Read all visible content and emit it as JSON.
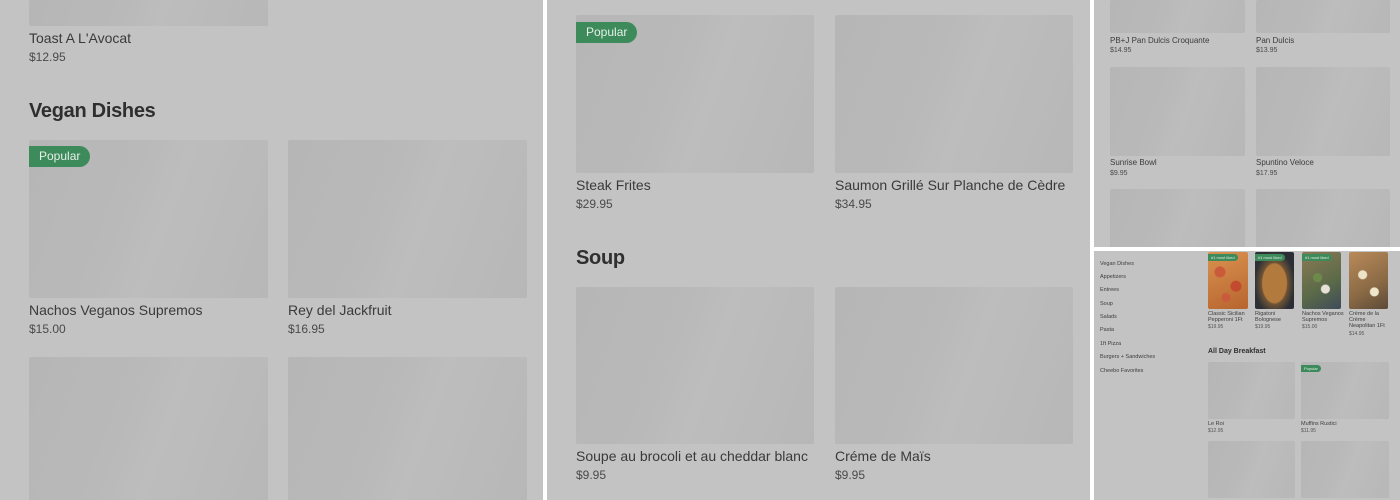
{
  "panel1": {
    "top_item": {
      "name": "Toast A L'Avocat",
      "price": "$12.95"
    },
    "section_title": "Vegan Dishes",
    "badge": "Popular",
    "items": [
      {
        "name": "Nachos Veganos Supremos",
        "price": "$15.00"
      },
      {
        "name": "Rey del Jackfruit",
        "price": "$16.95"
      }
    ]
  },
  "panel2": {
    "badge": "Popular",
    "items_top": [
      {
        "name": "Steak Frites",
        "price": "$29.95"
      },
      {
        "name": "Saumon Grillé Sur Planche de Cèdre",
        "price": "$34.95"
      }
    ],
    "section_title": "Soup",
    "items_soup": [
      {
        "name": "Soupe au brocoli et au cheddar blanc",
        "price": "$9.95"
      },
      {
        "name": "Créme de Maïs",
        "price": "$9.95"
      }
    ]
  },
  "panel3": {
    "items": [
      {
        "name": "PB+J Pan Dulcis Croquante",
        "price": "$14.95"
      },
      {
        "name": "Pan Dulcis",
        "price": "$13.95"
      },
      {
        "name": "Sunrise Bowl",
        "price": "$9.95"
      },
      {
        "name": "Spuntino Veloce",
        "price": "$17.95"
      }
    ]
  },
  "panel4": {
    "nav": [
      "Vegan Dishes",
      "Appetizers",
      "Entrees",
      "Soup",
      "Salads",
      "Pasta",
      "1ft Pizza",
      "Burgers + Sandwiches",
      "Cheebo Favorites"
    ],
    "featured_badge": "#1 most liked",
    "featured": [
      {
        "name": "Classic Sicilian Pepperoni 1Ft",
        "price": "$19.95"
      },
      {
        "name": "Rigatoni Bolognese",
        "price": "$19.95"
      },
      {
        "name": "Nachos Veganos Supremos",
        "price": "$15.00"
      },
      {
        "name": "Crème de la Crème Neapolitan 1Ft",
        "price": "$14.95"
      }
    ],
    "section_title": "All Day Breakfast",
    "badge": "Popular",
    "items": [
      {
        "name": "Le Roi",
        "price": "$12.95"
      },
      {
        "name": "Muffins Rustici",
        "price": "$11.95"
      }
    ]
  }
}
